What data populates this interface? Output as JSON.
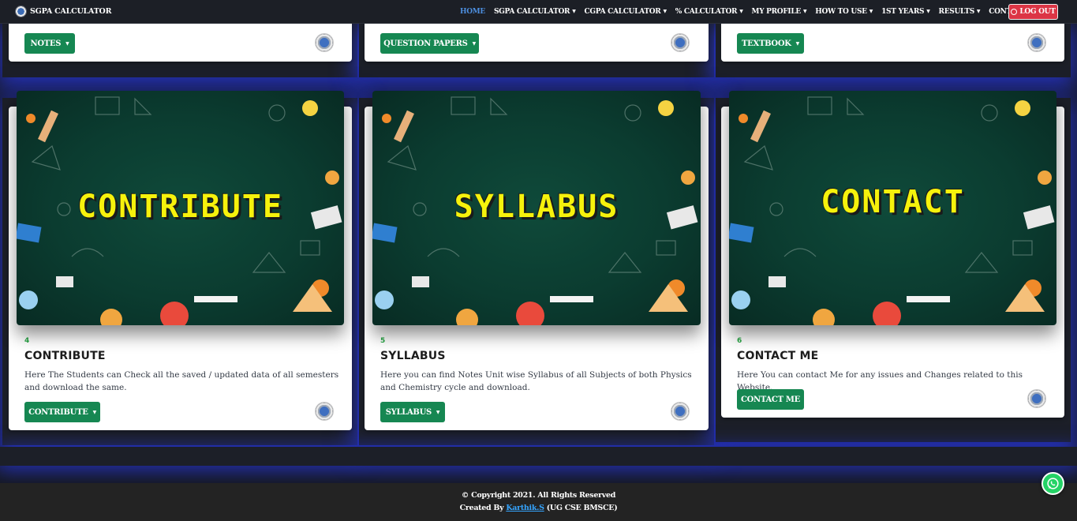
{
  "navbar": {
    "brand": "SGPA CALCULATOR",
    "items": [
      {
        "label": "HOME",
        "dropdown": false,
        "active": true
      },
      {
        "label": "SGPA CALCULATOR",
        "dropdown": true
      },
      {
        "label": "CGPA CALCULATOR",
        "dropdown": true
      },
      {
        "label": "% CALCULATOR",
        "dropdown": true
      },
      {
        "label": "MY PROFILE",
        "dropdown": true
      },
      {
        "label": "HOW TO USE",
        "dropdown": true
      },
      {
        "label": "1ST YEARS",
        "dropdown": true
      },
      {
        "label": "RESULTS",
        "dropdown": true
      },
      {
        "label": "CONTACT",
        "dropdown": false
      }
    ],
    "logout": "LOG OUT"
  },
  "top_cards": [
    {
      "button": "NOTES"
    },
    {
      "button": "QUESTION PAPERS"
    },
    {
      "button": "TEXTBOOK"
    }
  ],
  "cards": [
    {
      "image_text": "CONTRIBUTE",
      "number": "4",
      "title": "CONTRIBUTE",
      "description": "Here The Students can Check all the saved / updated data of all semesters and download the same.",
      "button": "CONTRIBUTE"
    },
    {
      "image_text": "SYLLABUS",
      "number": "5",
      "title": "SYLLABUS",
      "description": "Here you can find Notes Unit wise Syllabus of all Subjects of both Physics and Chemistry cycle and download.",
      "button": "SYLLABUS"
    },
    {
      "image_text": "CONTACT",
      "number": "6",
      "title": "CONTACT ME",
      "description": "Here You can contact Me for any issues and Changes related to this Website.",
      "button": "CONTACT ME"
    }
  ],
  "footer": {
    "copyright": "© Copyright 2021. All Rights Reserved",
    "created_by_prefix": "Created By ",
    "author": "Karthik.S",
    "suffix": " (UG CSE BMSCE)"
  },
  "colors": {
    "accent_green": "#168752",
    "number_green": "#28a745",
    "logout_red": "#dc3545",
    "active_nav": "#4d8fe0",
    "image_text_yellow": "#f6f20c"
  }
}
